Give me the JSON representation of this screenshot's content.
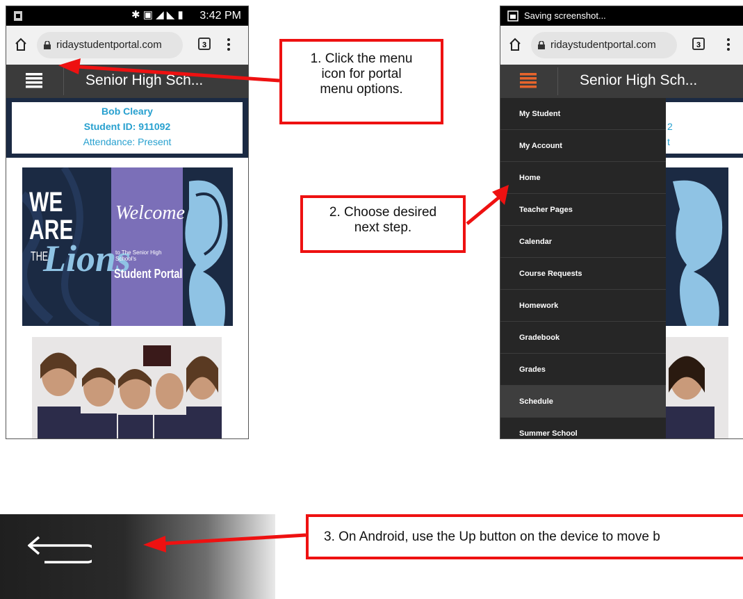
{
  "phone_left": {
    "status": {
      "time": "3:42 PM"
    },
    "browser": {
      "url": "ridaystudentportal.com",
      "tab_count": "3"
    },
    "nav": {
      "title": "Senior High Sch..."
    },
    "student": {
      "name": "Bob Cleary",
      "id_line": "Student ID: 911092",
      "attendance": "Attendance: Present"
    },
    "banner": {
      "line1": "WE ARE",
      "line2": "THE",
      "line3": "Lions",
      "welcome": "Welcome",
      "welcome_sub": "to The Senior High School's",
      "portal": "Student Portal"
    }
  },
  "phone_right": {
    "status": {
      "notification": "Saving screenshot..."
    },
    "browser": {
      "url": "ridaystudentportal.com",
      "tab_count": "3"
    },
    "nav": {
      "title": "Senior High Sch..."
    },
    "menu": {
      "items": [
        {
          "label": "My Student"
        },
        {
          "label": "My Account"
        },
        {
          "label": "Home"
        },
        {
          "label": "Teacher Pages"
        },
        {
          "label": "Calendar"
        },
        {
          "label": "Course Requests"
        },
        {
          "label": "Homework"
        },
        {
          "label": "Gradebook"
        },
        {
          "label": "Grades"
        },
        {
          "label": "Schedule"
        },
        {
          "label": "Summer School"
        }
      ],
      "active_index": 9
    },
    "peek": {
      "line2": "2",
      "line3": "t"
    }
  },
  "callouts": {
    "step1": [
      "1. Click the menu",
      "icon for portal",
      "menu options."
    ],
    "step2": [
      "2. Choose desired",
      "next step."
    ],
    "step3": "3. On Android, use the Up button on the device to move b"
  },
  "colors": {
    "annotation_red": "#ee1111",
    "nav_bar": "#3b3b3b",
    "menu_bg": "#262626",
    "student_text": "#27a0cf",
    "hamburger_active": "#e8642c",
    "banner_navy": "#1b2a43",
    "banner_purple": "#7b6fb8"
  },
  "icons": [
    "home-icon",
    "lock-icon",
    "tab-switcher-icon",
    "more-options-icon",
    "hamburger-menu-icon",
    "back-arrow-icon",
    "screenshot-icon"
  ]
}
